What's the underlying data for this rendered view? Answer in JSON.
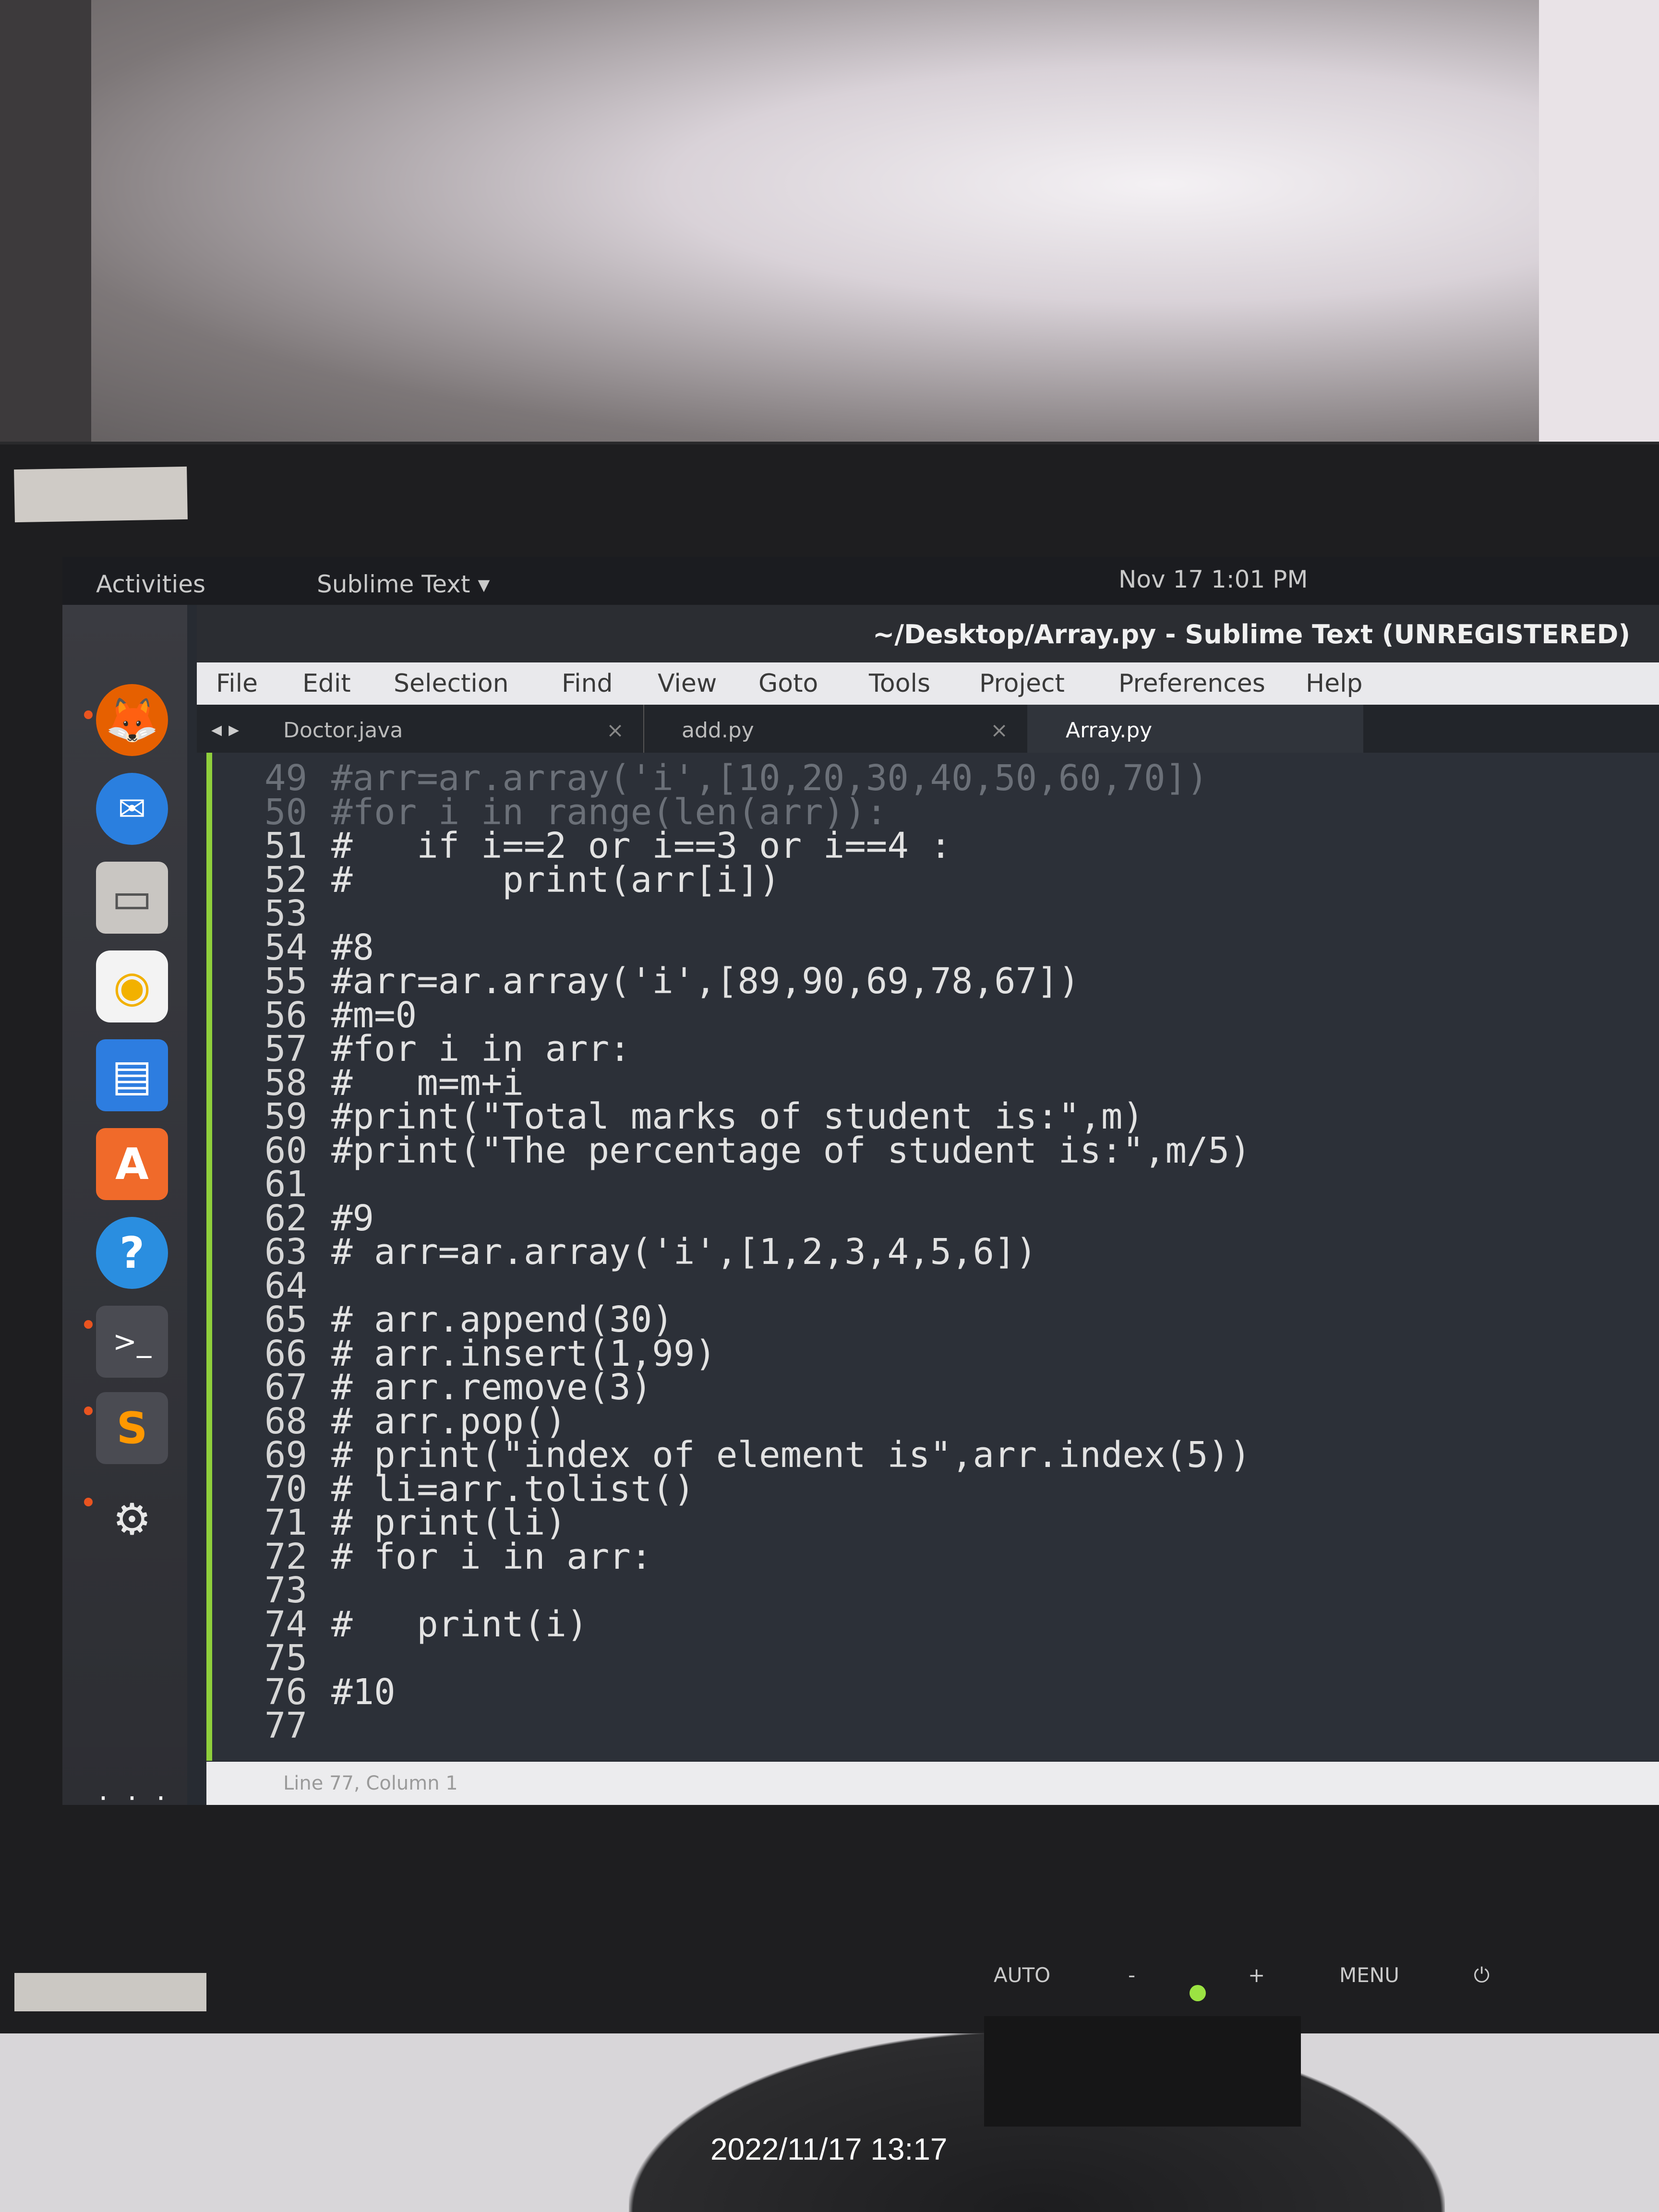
{
  "topbar": {
    "activities": "Activities",
    "app_menu": "Sublime Text ▾",
    "clock": "Nov 17  1:01 PM"
  },
  "window": {
    "title": "~/Desktop/Array.py - Sublime Text (UNREGISTERED)"
  },
  "menu": {
    "items": [
      "File",
      "Edit",
      "Selection",
      "Find",
      "View",
      "Goto",
      "Tools",
      "Project",
      "Preferences",
      "Help"
    ]
  },
  "tabs": [
    {
      "label": "Doctor.java",
      "close": "×"
    },
    {
      "label": "add.py",
      "close": "×"
    },
    {
      "label": "Array.py",
      "close": ""
    }
  ],
  "tab_nav": "◂ ▸",
  "editor": {
    "lines": [
      {
        "num": "49",
        "code": "#arr=ar.array('i',[10,20,30,40,50,60,70])"
      },
      {
        "num": "50",
        "code": "#for i in range(len(arr)):"
      },
      {
        "num": "51",
        "code": "#   if i==2 or i==3 or i==4 :"
      },
      {
        "num": "52",
        "code": "#       print(arr[i])"
      },
      {
        "num": "53",
        "code": ""
      },
      {
        "num": "54",
        "code": "#8"
      },
      {
        "num": "55",
        "code": "#arr=ar.array('i',[89,90,69,78,67])"
      },
      {
        "num": "56",
        "code": "#m=0"
      },
      {
        "num": "57",
        "code": "#for i in arr:"
      },
      {
        "num": "58",
        "code": "#   m=m+i"
      },
      {
        "num": "59",
        "code": "#print(\"Total marks of student is:\",m)"
      },
      {
        "num": "60",
        "code": "#print(\"The percentage of student is:\",m/5)"
      },
      {
        "num": "61",
        "code": ""
      },
      {
        "num": "62",
        "code": "#9"
      },
      {
        "num": "63",
        "code": "# arr=ar.array('i',[1,2,3,4,5,6])"
      },
      {
        "num": "64",
        "code": ""
      },
      {
        "num": "65",
        "code": "# arr.append(30)"
      },
      {
        "num": "66",
        "code": "# arr.insert(1,99)"
      },
      {
        "num": "67",
        "code": "# arr.remove(3)"
      },
      {
        "num": "68",
        "code": "# arr.pop()"
      },
      {
        "num": "69",
        "code": "# print(\"index of element is\",arr.index(5))"
      },
      {
        "num": "70",
        "code": "# li=arr.tolist()"
      },
      {
        "num": "71",
        "code": "# print(li)"
      },
      {
        "num": "72",
        "code": "# for i in arr:"
      },
      {
        "num": "73",
        "code": ""
      },
      {
        "num": "74",
        "code": "#   print(i)"
      },
      {
        "num": "75",
        "code": ""
      },
      {
        "num": "76",
        "code": "#10"
      },
      {
        "num": "77",
        "code": ""
      }
    ]
  },
  "status": {
    "position": "Line 77, Column 1"
  },
  "dock": {
    "items": [
      {
        "icon": "firefox-icon",
        "glyph": "🦊"
      },
      {
        "icon": "thunderbird-icon",
        "glyph": "✉"
      },
      {
        "icon": "files-icon",
        "glyph": "▭"
      },
      {
        "icon": "rhythmbox-icon",
        "glyph": "◉"
      },
      {
        "icon": "writer-icon",
        "glyph": "▤"
      },
      {
        "icon": "software-icon",
        "glyph": "A"
      },
      {
        "icon": "help-icon",
        "glyph": "?"
      },
      {
        "icon": "terminal-icon",
        "glyph": ">_"
      },
      {
        "icon": "sublime-icon",
        "glyph": "S"
      },
      {
        "icon": "settings-icon",
        "glyph": "⚙"
      },
      {
        "icon": "app-grid-icon",
        "glyph": "⋮⋮⋮"
      }
    ]
  },
  "monitor": {
    "auto": "AUTO",
    "minus": "-",
    "plus": "+",
    "menu": "MENU",
    "power": "⏻"
  },
  "photo_timestamp": "2022/11/17 13:17",
  "colors": {
    "editor_bg": "#2c3038",
    "gutter_accent": "#8fcf3c",
    "ubuntu_orange": "#e95420"
  }
}
